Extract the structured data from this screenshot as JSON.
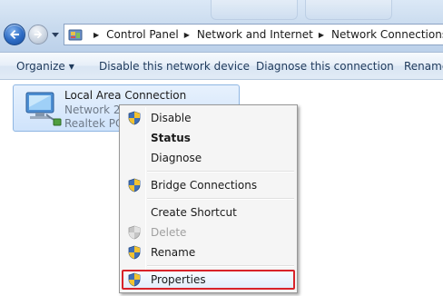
{
  "breadcrumb": {
    "items": [
      "Control Panel",
      "Network and Internet",
      "Network Connections"
    ]
  },
  "commandbar": {
    "organize": "Organize",
    "disable": "Disable this network device",
    "diagnose": "Diagnose this connection",
    "rename": "Rename"
  },
  "connection": {
    "name": "Local Area Connection",
    "network": "Network  2",
    "adapter": "Realtek PCI"
  },
  "context_menu": {
    "disable": "Disable",
    "status": "Status",
    "diagnose": "Diagnose",
    "bridge": "Bridge Connections",
    "shortcut": "Create Shortcut",
    "delete": "Delete",
    "rename": "Rename",
    "properties": "Properties"
  },
  "colors": {
    "highlight_border": "#d8232a",
    "selection_fill": "#cfe3fb",
    "commandbar_text": "#1e395b"
  }
}
